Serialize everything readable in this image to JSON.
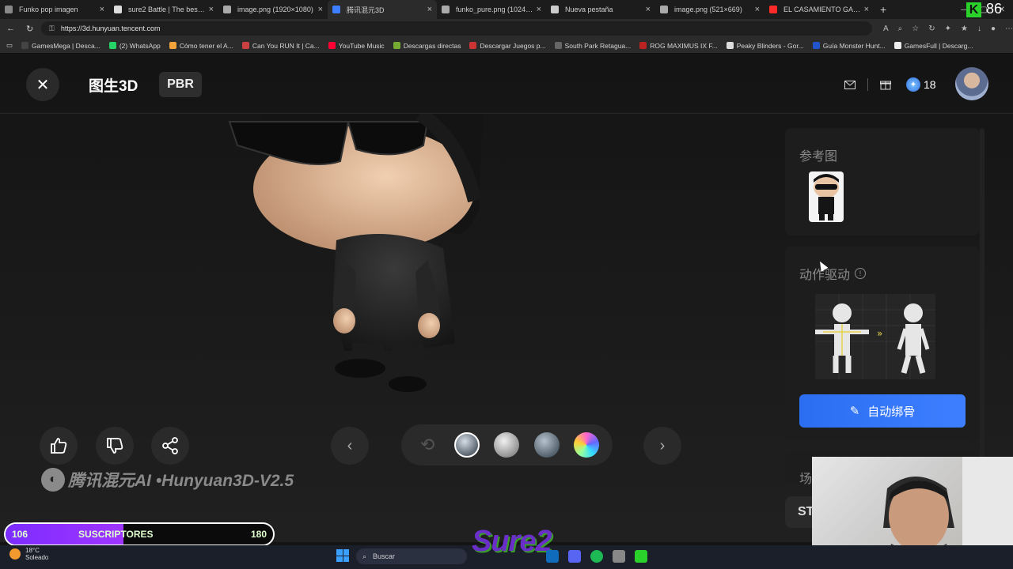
{
  "browser": {
    "tabs": [
      {
        "title": "Funko pop imagen",
        "icon": "gear-icon",
        "color": "#888888"
      },
      {
        "title": "sure2 Battle | The best Chat",
        "icon": "diamond-icon",
        "color": "#dddddd"
      },
      {
        "title": "image.png (1920×1080)",
        "icon": "globe-icon",
        "color": "#aaaaaa"
      },
      {
        "title": "腾讯混元3D",
        "icon": "hunyuan-icon",
        "color": "#3d7fff",
        "active": true
      },
      {
        "title": "funko_pure.png (1024×153",
        "icon": "globe-icon",
        "color": "#aaaaaa"
      },
      {
        "title": "Nueva pestaña",
        "icon": "newtab-icon",
        "color": "#cccccc"
      },
      {
        "title": "image.png (521×669)",
        "icon": "globe-icon",
        "color": "#aaaaaa"
      },
      {
        "title": "EL CASAMIENTO GANGSTE",
        "icon": "youtube-icon",
        "color": "#ff2a2a"
      }
    ],
    "new_tab": "+",
    "url": "https://3d.hunyuan.tencent.com",
    "bookmarks": [
      {
        "label": "GamesMega | Desca...",
        "color": "#444444"
      },
      {
        "label": "(2) WhatsApp",
        "color": "#25d366"
      },
      {
        "label": "Cómo tener el A...",
        "color": "#f2a23a"
      },
      {
        "label": "Can You RUN It | Ca...",
        "color": "#c94040"
      },
      {
        "label": "YouTube Music",
        "color": "#ff0033"
      },
      {
        "label": "Descargas directas",
        "color": "#77aa33"
      },
      {
        "label": "Descargar Juegos p...",
        "color": "#cc3333"
      },
      {
        "label": "South Park Retagua...",
        "color": "#666666"
      },
      {
        "label": "ROG MAXIMUS IX F...",
        "color": "#bb2222"
      },
      {
        "label": "Peaky Blinders - Gor...",
        "color": "#dddddd"
      },
      {
        "label": "Guía Monster Hunt...",
        "color": "#2255cc"
      },
      {
        "label": "GamesFull | Descarg...",
        "color": "#eeeeee"
      }
    ]
  },
  "overlay": {
    "badge_letter": "K",
    "badge_count": "86"
  },
  "app": {
    "title": "图生3D",
    "mode_badge": "PBR",
    "credits": "18",
    "reference_title": "参考图",
    "animation_title": "动作驱动",
    "auto_rig_label": "自动绑骨",
    "scene_title": "场",
    "st_button": "ST",
    "watermark": "腾讯混元AI •Hunyuan3D-V2.5",
    "accent": "#3d7fff"
  },
  "stream": {
    "sub_current": "106",
    "sub_label": "SUSCRIPTORES",
    "sub_goal": "180",
    "sub_progress": 0.44,
    "logo_text": "Sure2"
  },
  "taskbar": {
    "temperature": "18°C",
    "condition": "Soleado",
    "search_placeholder": "Buscar"
  }
}
